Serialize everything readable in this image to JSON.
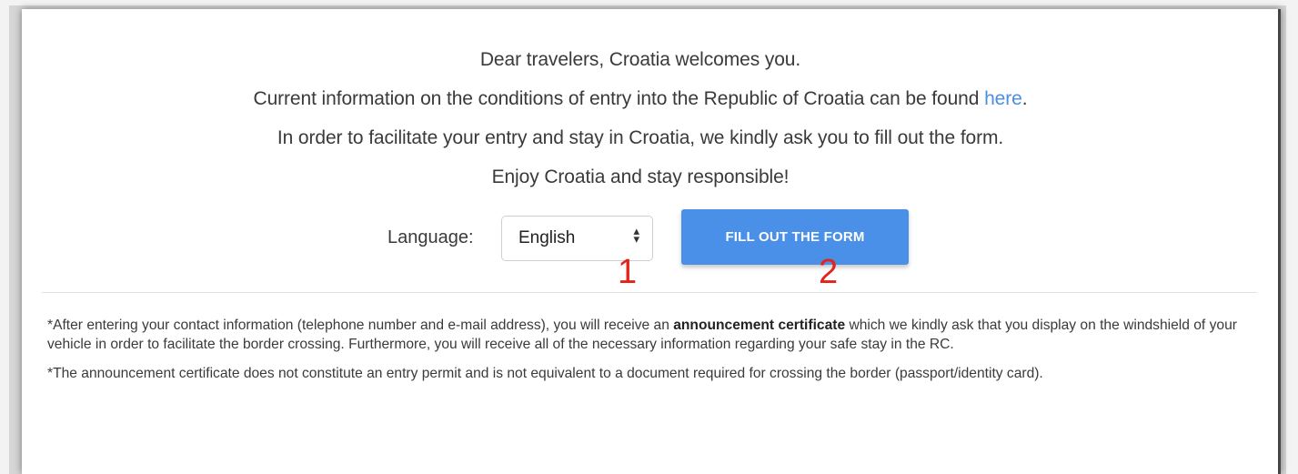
{
  "intro": {
    "line1": "Dear travelers, Croatia welcomes you.",
    "line2_before": "Current information on the conditions of entry into the Republic of Croatia can be found ",
    "line2_link": "here",
    "line2_after": ".",
    "line3": "In order to facilitate your entry and stay in Croatia, we kindly ask you to fill out the form.",
    "line4": "Enjoy Croatia and stay responsible!"
  },
  "language": {
    "label": "Language:",
    "selected": "English",
    "arrow_icon": "up-down-arrows-icon"
  },
  "form_button": {
    "label": "FILL OUT THE FORM",
    "color": "#4a90e8"
  },
  "markers": {
    "one": "1",
    "two": "2",
    "color": "#e2231a"
  },
  "notes": {
    "note1_before": "*After entering your contact information (telephone number and e-mail address), you will receive an ",
    "note1_bold": "announcement certificate",
    "note1_after": " which we kindly ask that you display on the windshield of your vehicle in order to facilitate the border crossing. Furthermore, you will receive all of the necessary information regarding your safe stay in the RC.",
    "note2": "*The announcement certificate does not constitute an entry permit and is not equivalent to a document required for crossing the border (passport/identity card)."
  }
}
